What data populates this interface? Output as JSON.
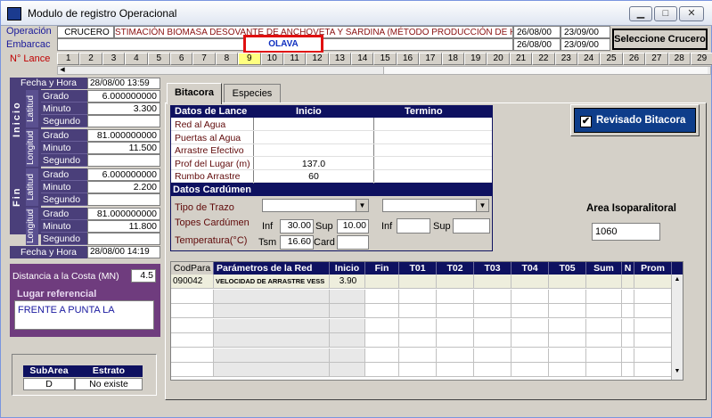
{
  "window": {
    "title": "Modulo de registro Operacional",
    "minimize": "▁",
    "maximize": "□",
    "close": "✕"
  },
  "header": {
    "operacion_label": "Operación",
    "embarcac_label": "Embarcac",
    "lance_label": "N° Lance",
    "crucero": "CRUCERO",
    "crucero_desc": "STIMACIÓN BIOMASA DESOVANTE DE ANCHOVETA Y SARDINA (MÉTODO PRODUCCIÓN DE H",
    "date1a": "26/08/00",
    "date1b": "23/09/00",
    "vessel": "OLAVA",
    "date2a": "26/08/00",
    "date2b": "23/09/00",
    "select_button": "Seleccione Crucero"
  },
  "lances": [
    "1",
    "2",
    "3",
    "4",
    "5",
    "6",
    "7",
    "8",
    "9",
    "10",
    "11",
    "12",
    "13",
    "14",
    "15",
    "16",
    "17",
    "18",
    "19",
    "20",
    "21",
    "22",
    "23",
    "24",
    "25",
    "26",
    "27",
    "28",
    "29"
  ],
  "left": {
    "fecha_hora_label": "Fecha y Hora",
    "inicio_fecha": "28/08/00 13:59",
    "inicio_label": "Inicio",
    "fin_label": "Fin",
    "latitud_label": "Latitud",
    "longitud_label": "Longitud",
    "grado": "Grado",
    "minuto": "Minuto",
    "segundo": "Segundo",
    "ini_lat_grado": "6.000000000",
    "ini_lat_min": "3.300",
    "ini_lat_seg": "",
    "ini_lon_grado": "81.000000000",
    "ini_lon_min": "11.500",
    "ini_lon_seg": "",
    "fin_lat_grado": "6.000000000",
    "fin_lat_min": "2.200",
    "fin_lat_seg": "",
    "fin_lon_grado": "81.000000000",
    "fin_lon_min": "11.800",
    "fin_lon_seg": "",
    "fin_fecha": "28/08/00 14:19",
    "distancia_label": "Distancia a la Costa (MN)",
    "distancia": "4.5",
    "lugar_label": "Lugar referencial",
    "lugar": "FRENTE A PUNTA LA",
    "subarea_label": "SubArea",
    "estrato_label": "Estrato",
    "subarea": "D",
    "estrato": "No existe"
  },
  "tabs": {
    "bitacora": "Bitacora",
    "especies": "Especies"
  },
  "lance_table": {
    "title": "Datos de Lance",
    "inicio": "Inicio",
    "termino": "Termino",
    "rows": [
      {
        "label": "Red al Agua",
        "inicio": "",
        "termino": ""
      },
      {
        "label": "Puertas al Agua",
        "inicio": "",
        "termino": ""
      },
      {
        "label": "Arrastre Efectivo",
        "inicio": "",
        "termino": ""
      },
      {
        "label": "Prof del Lugar (m)",
        "inicio": "137.0",
        "termino": ""
      },
      {
        "label": "Rumbo Arrastre",
        "inicio": "60",
        "termino": ""
      }
    ]
  },
  "cardumen": {
    "title": "Datos Cardúmen",
    "tipo_trazo": "Tipo de Trazo",
    "topes": "Topes Cardúmen",
    "temperatura": "Temperatura(°C)",
    "inf": "Inf",
    "sup": "Sup",
    "tsm": "Tsm",
    "card": "Card",
    "inf_val": "30.00",
    "sup_val": "10.00",
    "tsm_val": "16.60",
    "card_val": "",
    "inf2_val": "",
    "sup2_val": ""
  },
  "revisado": {
    "label": "Revisado Bitacora",
    "checked": true
  },
  "area_iso": {
    "label": "Area Isoparalitoral",
    "value": "1060"
  },
  "red_table": {
    "headers": [
      "CodPara",
      "Parámetros de la Red",
      "Inicio",
      "Fin",
      "T01",
      "T02",
      "T03",
      "T04",
      "T05",
      "Sum",
      "N",
      "Prom"
    ],
    "rows": [
      [
        "090042",
        "VELOCIDAD DE ARRASTRE VESS",
        "3.90",
        "",
        "",
        "",
        "",
        "",
        "",
        "",
        "",
        ""
      ]
    ]
  }
}
